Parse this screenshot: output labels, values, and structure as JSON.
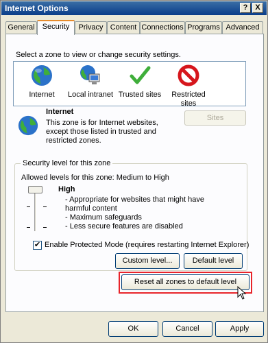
{
  "window": {
    "title": "Internet Options",
    "help_label": "?",
    "close_label": "X"
  },
  "tabs": [
    {
      "label": "General"
    },
    {
      "label": "Security"
    },
    {
      "label": "Privacy"
    },
    {
      "label": "Content"
    },
    {
      "label": "Connections"
    },
    {
      "label": "Programs"
    },
    {
      "label": "Advanced"
    }
  ],
  "security": {
    "prompt": "Select a zone to view or change security settings.",
    "zones": [
      {
        "label": "Internet",
        "icon": "globe-icon"
      },
      {
        "label": "Local intranet",
        "icon": "intranet-icon"
      },
      {
        "label": "Trusted sites",
        "icon": "checkmark-icon"
      },
      {
        "label": "Restricted sites",
        "icon": "prohibited-icon"
      }
    ],
    "selected_zone": {
      "name": "Internet",
      "description": "This zone is for Internet websites, except those listed in trusted and restricted zones."
    },
    "sites_button": "Sites",
    "group_label": "Security level for this zone",
    "allowed_levels": "Allowed levels for this zone: Medium to High",
    "level": {
      "name": "High",
      "bullets": [
        "- Appropriate for websites that might have harmful content",
        "- Maximum safeguards",
        "- Less secure features are disabled"
      ]
    },
    "protected_mode_label": "Enable Protected Mode (requires restarting Internet Explorer)",
    "protected_mode_checked": true,
    "custom_level_button": "Custom level...",
    "default_level_button": "Default level",
    "reset_all_button": "Reset all zones to default level"
  },
  "footer": {
    "ok": "OK",
    "cancel": "Cancel",
    "apply": "Apply"
  },
  "colors": {
    "highlight": "#e8242a",
    "title_bar": "#0a3d8a"
  }
}
